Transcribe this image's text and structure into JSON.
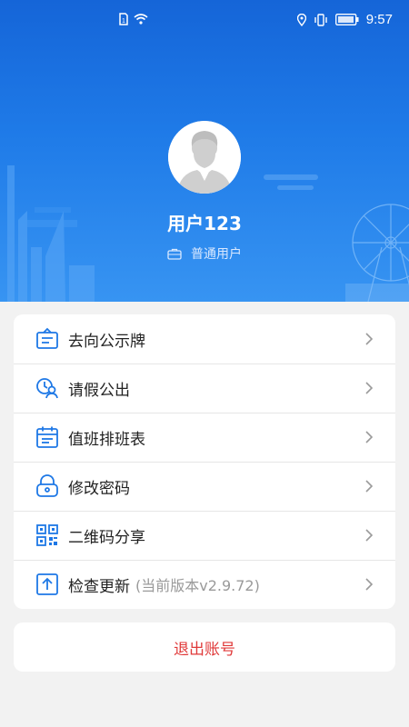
{
  "status_bar": {
    "time": "9:57",
    "icons": [
      "sim-icon",
      "wifi-icon",
      "location-icon",
      "vibrate-icon",
      "battery-icon"
    ]
  },
  "profile": {
    "username": "用户123",
    "role": "普通用户"
  },
  "menu": {
    "items": [
      {
        "label": "去向公示牌",
        "icon": "board-icon"
      },
      {
        "label": "请假公出",
        "icon": "leave-icon"
      },
      {
        "label": "值班排班表",
        "icon": "calendar-icon"
      },
      {
        "label": "修改密码",
        "icon": "lock-icon"
      },
      {
        "label": "二维码分享",
        "icon": "qrcode-icon"
      },
      {
        "label": "检查更新",
        "icon": "upload-icon",
        "extra": "(当前版本v2.9.72)"
      }
    ]
  },
  "logout": {
    "label": "退出账号"
  },
  "colors": {
    "accent": "#1e78e6",
    "logout": "#e03a3a"
  }
}
